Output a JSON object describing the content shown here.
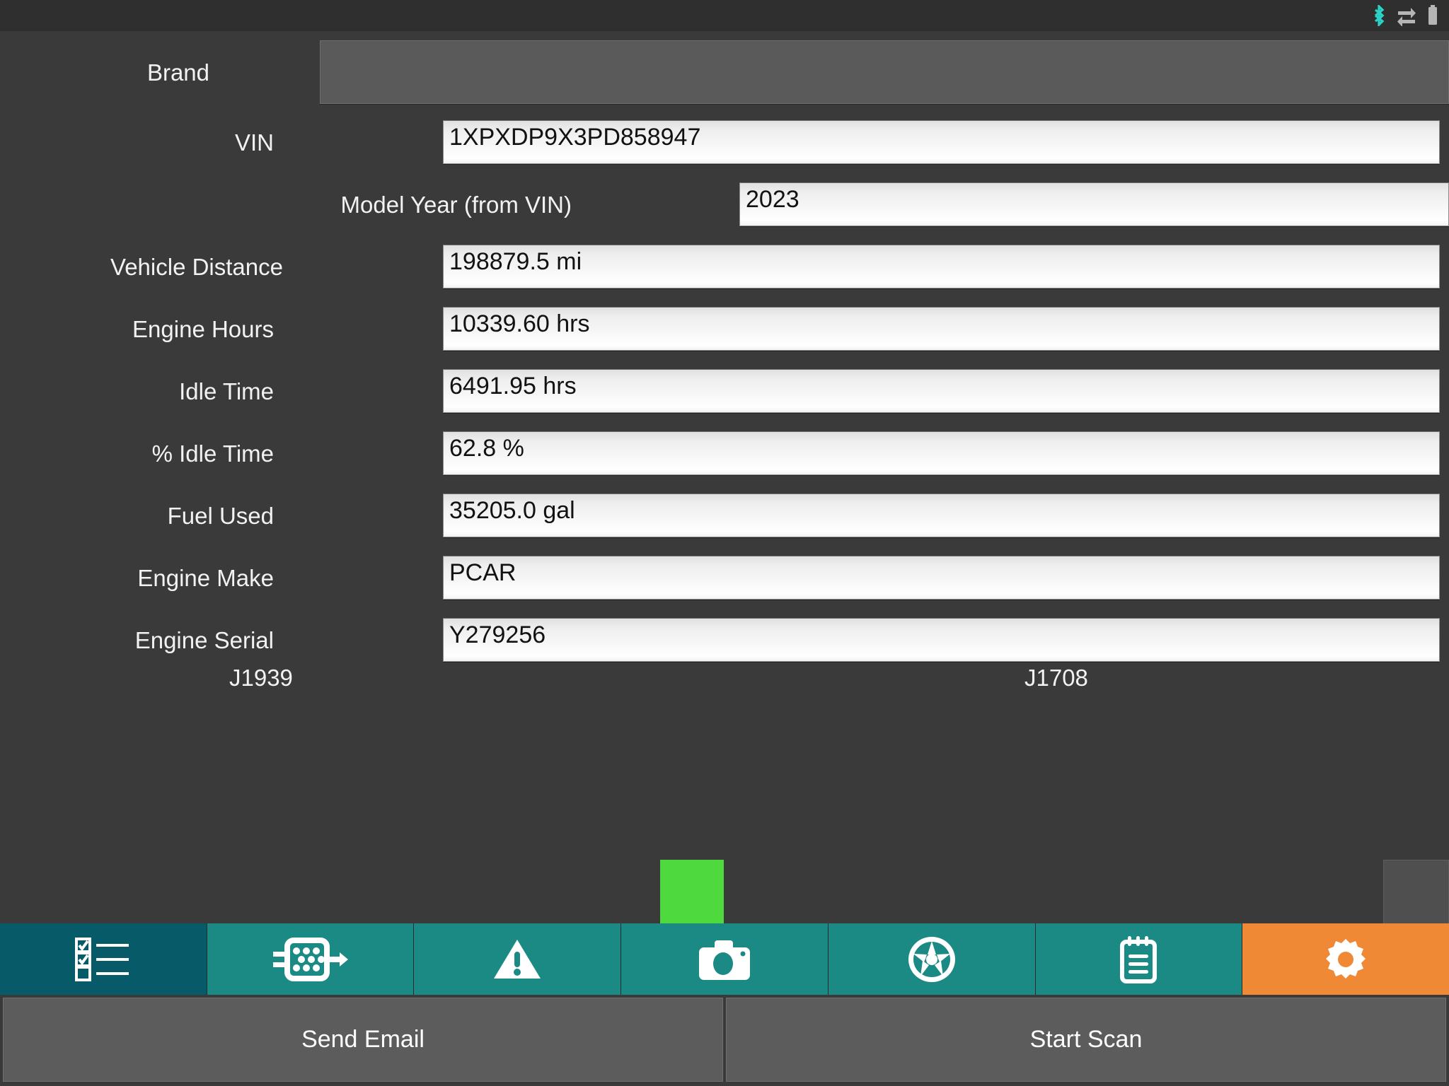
{
  "statusbar": {
    "icons": [
      {
        "name": "bluetooth-icon",
        "color": "#2ad4c8"
      },
      {
        "name": "data-transfer-icon",
        "color": "#b5b5b5"
      },
      {
        "name": "battery-icon",
        "color": "#b5b5b5"
      }
    ]
  },
  "form": {
    "rows": [
      {
        "label": "Brand",
        "value": "",
        "type": "empty"
      },
      {
        "label": "VIN",
        "value": "1XPXDP9X3PD858947",
        "type": "text"
      },
      {
        "label": "Model Year (from VIN)",
        "value": "2023",
        "type": "text"
      },
      {
        "label": "Vehicle Distance",
        "value": "198879.5 mi",
        "type": "text"
      },
      {
        "label": "Engine Hours",
        "value": "10339.60 hrs",
        "type": "text"
      },
      {
        "label": "Idle Time",
        "value": "6491.95 hrs",
        "type": "text"
      },
      {
        "label": "% Idle Time",
        "value": "62.8 %",
        "type": "text"
      },
      {
        "label": "Fuel Used",
        "value": "35205.0 gal",
        "type": "text"
      },
      {
        "label": "Engine Make",
        "value": "PCAR",
        "type": "text"
      },
      {
        "label": "Engine Serial",
        "value": "Y279256",
        "type": "text"
      }
    ]
  },
  "protocols": [
    {
      "label": "J1939",
      "status_color": "#4ed93f",
      "connected": true
    },
    {
      "label": "J1708",
      "status_color": "#4f4f4f",
      "connected": false
    }
  ],
  "tabbar": {
    "active_color": "#075b69",
    "inactive_color": "#1b8a85",
    "settings_color": "#ef8935",
    "tabs": [
      {
        "name": "tab-checklist",
        "icon": "checklist-icon",
        "state": "active"
      },
      {
        "name": "tab-connector",
        "icon": "connector-icon",
        "state": "inactive"
      },
      {
        "name": "tab-faults",
        "icon": "warning-icon",
        "state": "inactive"
      },
      {
        "name": "tab-camera",
        "icon": "camera-icon",
        "state": "inactive"
      },
      {
        "name": "tab-wheel",
        "icon": "wheel-icon",
        "state": "inactive"
      },
      {
        "name": "tab-notes",
        "icon": "notepad-icon",
        "state": "inactive"
      },
      {
        "name": "tab-settings",
        "icon": "gear-icon",
        "state": "settings"
      }
    ]
  },
  "buttons": {
    "send_email": "Send Email",
    "start_scan": "Start Scan"
  },
  "colors": {
    "background": "#3a3a3a",
    "statusbar": "#2f2f2f",
    "field_text": "#121212",
    "label_text": "#f2f2f2"
  }
}
